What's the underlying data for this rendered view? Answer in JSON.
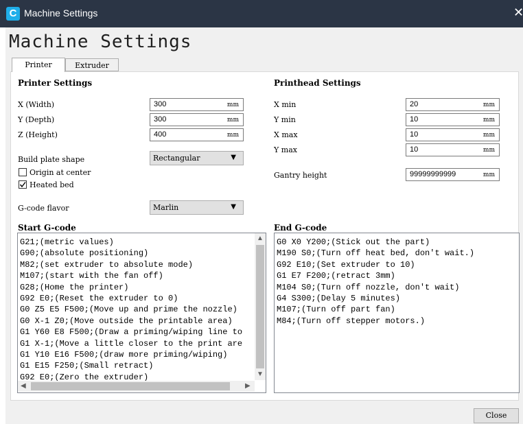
{
  "window": {
    "title": "Machine Settings",
    "close_glyph": "✕",
    "icon_letter": "C",
    "icon_color": "#1faee9",
    "titlebar_color": "#2b3545"
  },
  "page_title": "Machine Settings",
  "tabs": [
    {
      "label": "Printer",
      "active": true
    },
    {
      "label": "Extruder",
      "active": false
    }
  ],
  "printer_settings": {
    "title": "Printer Settings",
    "fields": [
      {
        "label": "X (Width)",
        "value": "300",
        "unit": "mm"
      },
      {
        "label": "Y (Depth)",
        "value": "300",
        "unit": "mm"
      },
      {
        "label": "Z (Height)",
        "value": "400",
        "unit": "mm"
      }
    ],
    "build_plate": {
      "label": "Build plate shape",
      "value": "Rectangular"
    },
    "origin_at_center": {
      "label": "Origin at center",
      "checked": false
    },
    "heated_bed": {
      "label": "Heated bed",
      "checked": true
    },
    "gcode_flavor": {
      "label": "G-code flavor",
      "value": "Marlin"
    }
  },
  "printhead_settings": {
    "title": "Printhead Settings",
    "fields": [
      {
        "label": "X min",
        "value": "20",
        "unit": "mm"
      },
      {
        "label": "Y min",
        "value": "10",
        "unit": "mm"
      },
      {
        "label": "X max",
        "value": "10",
        "unit": "mm"
      },
      {
        "label": "Y max",
        "value": "10",
        "unit": "mm"
      }
    ],
    "gantry": {
      "label": "Gantry height",
      "value": "99999999999",
      "unit": "mm"
    }
  },
  "start_gcode": {
    "title": "Start G-code",
    "text": "G21;(metric values)\nG90;(absolute positioning)\nM82;(set extruder to absolute mode)\nM107;(start with the fan off)\nG28;(Home the printer)\nG92 E0;(Reset the extruder to 0)\nG0 Z5 E5 F500;(Move up and prime the nozzle)\nG0 X-1 Z0;(Move outside the printable area)\nG1 Y60 E8 F500;(Draw a priming/wiping line to\nG1 X-1;(Move a little closer to the print are\nG1 Y10 E16 F500;(draw more priming/wiping)\nG1 E15 F250;(Small retract)\nG92 E0;(Zero the extruder)"
  },
  "end_gcode": {
    "title": "End G-code",
    "text": "G0 X0 Y200;(Stick out the part)\nM190 S0;(Turn off heat bed, don't wait.)\nG92 E10;(Set extruder to 10)\nG1 E7 F200;(retract 3mm)\nM104 S0;(Turn off nozzle, don't wait)\nG4 S300;(Delay 5 minutes)\nM107;(Turn off part fan)\nM84;(Turn off stepper motors.)"
  },
  "close_button": "Close"
}
